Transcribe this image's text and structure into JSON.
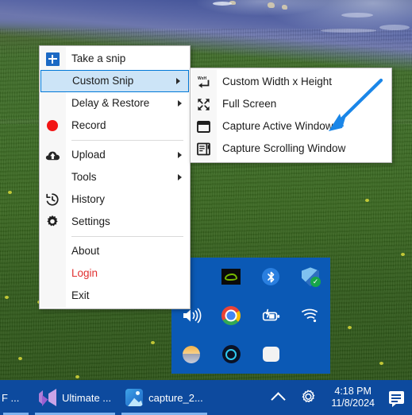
{
  "app": {
    "window_title": "Snipping tool tray context menu over Windows desktop"
  },
  "main_menu": {
    "items": [
      {
        "label": "Take a snip",
        "icon": "plus-square-icon",
        "submenu": false,
        "separator_after": false,
        "highlighted": false
      },
      {
        "label": "Custom Snip",
        "icon": "none",
        "submenu": true,
        "separator_after": false,
        "highlighted": true
      },
      {
        "label": "Delay & Restore",
        "icon": "none",
        "submenu": true,
        "separator_after": false,
        "highlighted": false
      },
      {
        "label": "Record",
        "icon": "record-dot-icon",
        "submenu": false,
        "separator_after": true,
        "highlighted": false
      },
      {
        "label": "Upload",
        "icon": "cloud-upload-icon",
        "submenu": true,
        "separator_after": false,
        "highlighted": false
      },
      {
        "label": "Tools",
        "icon": "none",
        "submenu": true,
        "separator_after": false,
        "highlighted": false
      },
      {
        "label": "History",
        "icon": "history-clock-icon",
        "submenu": false,
        "separator_after": false,
        "highlighted": false
      },
      {
        "label": "Settings",
        "icon": "gear-icon",
        "submenu": false,
        "separator_after": true,
        "highlighted": false
      },
      {
        "label": "About",
        "icon": "none",
        "submenu": false,
        "separator_after": false,
        "highlighted": false
      },
      {
        "label": "Login",
        "icon": "none",
        "submenu": false,
        "separator_after": false,
        "highlighted": false,
        "style": "login"
      },
      {
        "label": "Exit",
        "icon": "none",
        "submenu": false,
        "separator_after": false,
        "highlighted": false
      }
    ],
    "highlight_fill": "#cce4f7",
    "highlight_border": "#0078d7",
    "login_color": "#e03030"
  },
  "sub_menu": {
    "parent": "Custom Snip",
    "items": [
      {
        "label": "Custom Width x Height",
        "icon": "width-height-enter-icon"
      },
      {
        "label": "Full Screen",
        "icon": "fullscreen-expand-icon"
      },
      {
        "label": "Capture Active Window",
        "icon": "window-frame-icon"
      },
      {
        "label": "Capture Scrolling Window",
        "icon": "scrolling-window-icon"
      }
    ]
  },
  "annotation": {
    "type": "arrow",
    "color": "#1a86e8",
    "points_to": "Capture Scrolling Window"
  },
  "tray_panel": {
    "background": "#0b59b5",
    "icons": [
      {
        "name": "empty-slot",
        "glyph": "none"
      },
      {
        "name": "nvidia-settings-icon",
        "glyph": "nvidia"
      },
      {
        "name": "bluetooth-icon",
        "glyph": "bluetooth"
      },
      {
        "name": "windows-security-icon",
        "glyph": "shield-check"
      },
      {
        "name": "volume-icon",
        "glyph": "speaker"
      },
      {
        "name": "google-chrome-icon",
        "glyph": "chrome"
      },
      {
        "name": "battery-charging-icon",
        "glyph": "battery-bolt"
      },
      {
        "name": "wifi-icon",
        "glyph": "wifi"
      },
      {
        "name": "weather-icon",
        "glyph": "sun-cloud"
      },
      {
        "name": "cortana-icon",
        "glyph": "cortana-ring"
      },
      {
        "name": "white-app-icon",
        "glyph": "white-rounded"
      },
      {
        "name": "empty-slot-2",
        "glyph": "none"
      }
    ]
  },
  "taskbar": {
    "background": "#0d4a9e",
    "left_fragment_label": "F ...",
    "buttons": [
      {
        "label": "Ultimate ...",
        "icon": "visual-studio-icon",
        "active": true
      },
      {
        "label": "capture_2...",
        "icon": "photos-app-icon",
        "active": true
      }
    ],
    "show_hidden_icons": "chevron-up-icon",
    "settings_icon": "gear-icon",
    "clock": {
      "time": "4:18 PM",
      "date": "11/8/2024"
    },
    "action_center_icon": "notification-icon"
  },
  "desktop": {
    "wallpaper": "green grass hill with mountains"
  }
}
